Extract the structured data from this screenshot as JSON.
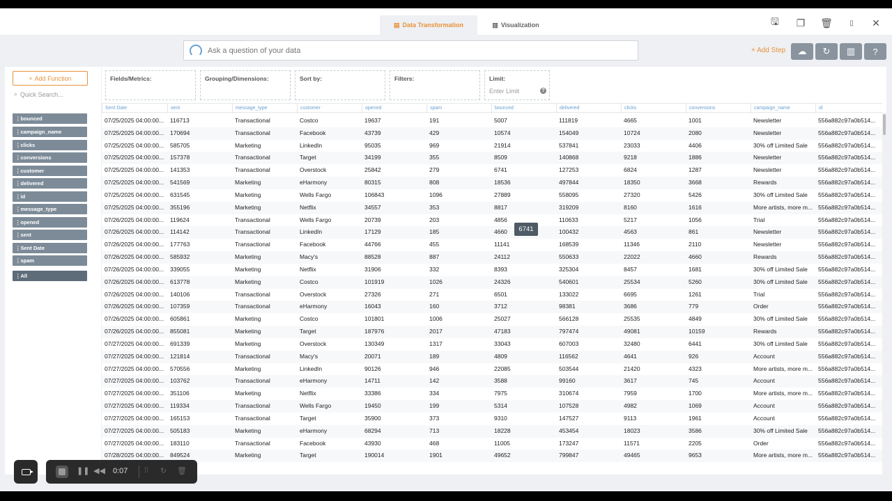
{
  "header": {
    "tabs": [
      {
        "label": "Data Transformation",
        "icon": "table-icon",
        "active": true
      },
      {
        "label": "Visualization",
        "icon": "bar-chart-icon",
        "active": false
      }
    ],
    "icons": [
      "save-icon",
      "copy-icon",
      "delete-icon",
      "pdf-icon",
      "close-icon"
    ]
  },
  "ask": {
    "placeholder": "Ask a question of your data"
  },
  "toolbar": {
    "add_step": "Add Step",
    "buttons": [
      "cloud-download-icon",
      "refresh-icon",
      "chart-icon",
      "help-icon"
    ]
  },
  "sidebar": {
    "add_function": "Add Function",
    "quick_search_placeholder": "Quick Search...",
    "fields": [
      "bounced",
      "campaign_name",
      "clicks",
      "conversions",
      "customer",
      "delivered",
      "id",
      "message_type",
      "opened",
      "sent",
      "Sent Date",
      "spam"
    ],
    "all_label": "All"
  },
  "slots": {
    "fields_metrics": "Fields/Metrics:",
    "grouping": "Grouping/Dimensions:",
    "sort_by": "Sort by:",
    "filters": "Filters:",
    "limit": "Limit:",
    "limit_placeholder": "Enter Limit"
  },
  "table": {
    "columns": [
      "Sent Date",
      "sent",
      "message_type",
      "customer",
      "opened",
      "spam",
      "bounced",
      "delivered",
      "clicks",
      "conversions",
      "campaign_name",
      "id"
    ],
    "rows": [
      [
        "07/25/2025 04:00:00...",
        "116713",
        "Transactional",
        "Costco",
        "19637",
        "191",
        "5007",
        "111819",
        "4665",
        "1001",
        "Newsletter",
        "556a882c97a0b514..."
      ],
      [
        "07/25/2025 04:00:00...",
        "170694",
        "Transactional",
        "Facebook",
        "43739",
        "429",
        "10574",
        "154049",
        "10724",
        "2080",
        "Newsletter",
        "556a882c97a0b514..."
      ],
      [
        "07/25/2025 04:00:00...",
        "585705",
        "Marketing",
        "LinkedIn",
        "95035",
        "969",
        "21914",
        "537841",
        "23033",
        "4406",
        "30% off Limited Sale",
        "556a882c97a0b514..."
      ],
      [
        "07/25/2025 04:00:00...",
        "157378",
        "Transactional",
        "Target",
        "34199",
        "355",
        "8509",
        "140868",
        "9218",
        "1886",
        "Newsletter",
        "556a882c97a0b514..."
      ],
      [
        "07/25/2025 04:00:00...",
        "141353",
        "Transactional",
        "Overstock",
        "25842",
        "279",
        "6741",
        "127253",
        "6824",
        "1287",
        "Newsletter",
        "556a882c97a0b514..."
      ],
      [
        "07/25/2025 04:00:00...",
        "541569",
        "Marketing",
        "eHarmony",
        "80315",
        "808",
        "18536",
        "497844",
        "18350",
        "3668",
        "Rewards",
        "556a882c97a0b514..."
      ],
      [
        "07/25/2025 04:00:00...",
        "631545",
        "Marketing",
        "Wells Fargo",
        "106843",
        "1096",
        "27889",
        "558095",
        "27320",
        "5426",
        "30% off Limited Sale",
        "556a882c97a0b514..."
      ],
      [
        "07/25/2025 04:00:00...",
        "355196",
        "Marketing",
        "Netflix",
        "34557",
        "353",
        "8817",
        "319209",
        "8160",
        "1616",
        "More artists, more m...",
        "556a882c97a0b514..."
      ],
      [
        "07/26/2025 04:00:00...",
        "119624",
        "Transactional",
        "Wells Fargo",
        "20739",
        "203",
        "4856",
        "110633",
        "5217",
        "1056",
        "Trial",
        "556a882c97a0b514..."
      ],
      [
        "07/26/2025 04:00:00...",
        "114142",
        "Transactional",
        "LinkedIn",
        "17129",
        "185",
        "4660",
        "100432",
        "4563",
        "861",
        "Newsletter",
        "556a882c97a0b514..."
      ],
      [
        "07/26/2025 04:00:00...",
        "177763",
        "Transactional",
        "Facebook",
        "44766",
        "455",
        "11141",
        "168539",
        "11346",
        "2110",
        "Newsletter",
        "556a882c97a0b514..."
      ],
      [
        "07/26/2025 04:00:00...",
        "585932",
        "Marketing",
        "Macy's",
        "88528",
        "887",
        "24112",
        "550633",
        "22022",
        "4660",
        "Rewards",
        "556a882c97a0b514..."
      ],
      [
        "07/26/2025 04:00:00...",
        "339055",
        "Marketing",
        "Netflix",
        "31906",
        "332",
        "8393",
        "325304",
        "8457",
        "1681",
        "30% off Limited Sale",
        "556a882c97a0b514..."
      ],
      [
        "07/26/2025 04:00:00...",
        "613778",
        "Marketing",
        "Costco",
        "101919",
        "1026",
        "24326",
        "540601",
        "25534",
        "5260",
        "30% off Limited Sale",
        "556a882c97a0b514..."
      ],
      [
        "07/26/2025 04:00:00...",
        "140106",
        "Transactional",
        "Overstock",
        "27326",
        "271",
        "6501",
        "133022",
        "6695",
        "1261",
        "Trial",
        "556a882c97a0b514..."
      ],
      [
        "07/26/2025 04:00:00...",
        "107359",
        "Transactional",
        "eHarmony",
        "16043",
        "160",
        "3712",
        "98381",
        "3686",
        "779",
        "Order",
        "556a882c97a0b514..."
      ],
      [
        "07/26/2025 04:00:00...",
        "605861",
        "Marketing",
        "Costco",
        "101801",
        "1006",
        "25027",
        "566128",
        "25535",
        "4849",
        "30% off Limited Sale",
        "556a882c97a0b514..."
      ],
      [
        "07/26/2025 04:00:00...",
        "855081",
        "Marketing",
        "Target",
        "187976",
        "2017",
        "47183",
        "797474",
        "49081",
        "10159",
        "Rewards",
        "556a882c97a0b514..."
      ],
      [
        "07/27/2025 04:00:00...",
        "691339",
        "Marketing",
        "Overstock",
        "130349",
        "1317",
        "33043",
        "607003",
        "32480",
        "6441",
        "30% off Limited Sale",
        "556a882c97a0b514..."
      ],
      [
        "07/27/2025 04:00:00...",
        "121814",
        "Transactional",
        "Macy's",
        "20071",
        "189",
        "4809",
        "116562",
        "4641",
        "926",
        "Account",
        "556a882c97a0b514..."
      ],
      [
        "07/27/2025 04:00:00...",
        "570556",
        "Marketing",
        "LinkedIn",
        "90126",
        "946",
        "22085",
        "503544",
        "21420",
        "4323",
        "More artists, more m...",
        "556a882c97a0b514..."
      ],
      [
        "07/27/2025 04:00:00...",
        "103762",
        "Transactional",
        "eHarmony",
        "14711",
        "142",
        "3588",
        "99160",
        "3617",
        "745",
        "Account",
        "556a882c97a0b514..."
      ],
      [
        "07/27/2025 04:00:00...",
        "351106",
        "Marketing",
        "Netflix",
        "33386",
        "334",
        "7975",
        "310674",
        "7959",
        "1700",
        "More artists, more m...",
        "556a882c97a0b514..."
      ],
      [
        "07/27/2025 04:00:00...",
        "119334",
        "Transactional",
        "Wells Fargo",
        "19450",
        "199",
        "5314",
        "107528",
        "4982",
        "1069",
        "Account",
        "556a882c97a0b514..."
      ],
      [
        "07/27/2025 04:00:00...",
        "165153",
        "Transactional",
        "Target",
        "35900",
        "373",
        "9310",
        "147527",
        "9113",
        "1961",
        "Account",
        "556a882c97a0b514..."
      ],
      [
        "07/27/2025 04:00:00...",
        "505183",
        "Marketing",
        "eHarmony",
        "68294",
        "713",
        "18228",
        "453454",
        "18023",
        "3586",
        "30% off Limited Sale",
        "556a882c97a0b514..."
      ],
      [
        "07/27/2025 04:00:00...",
        "183110",
        "Transactional",
        "Facebook",
        "43930",
        "468",
        "11005",
        "173247",
        "11571",
        "2205",
        "Order",
        "556a882c97a0b514..."
      ],
      [
        "07/28/2025 04:00:00...",
        "849524",
        "Marketing",
        "Target",
        "190014",
        "1901",
        "49652",
        "799847",
        "49465",
        "9653",
        "More artists, more m...",
        "556a882c97a0b514..."
      ]
    ]
  },
  "tooltip": {
    "value": "6741"
  },
  "recorder": {
    "time": "0:07"
  }
}
